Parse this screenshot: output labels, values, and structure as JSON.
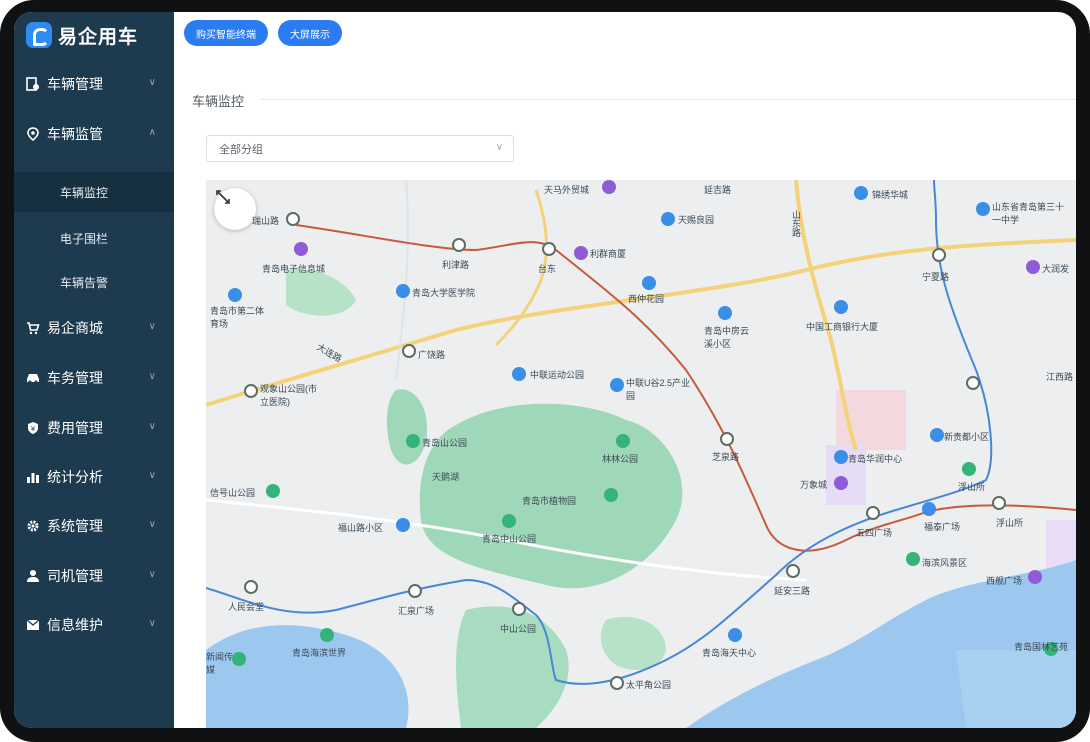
{
  "app": {
    "title": "易企用车"
  },
  "sidebar": {
    "items": [
      {
        "label": "车辆管理",
        "icon": "car-doc-icon"
      },
      {
        "label": "车辆监管",
        "icon": "location-pin-icon"
      },
      {
        "label": "易企商城",
        "icon": "cart-icon"
      },
      {
        "label": "车务管理",
        "icon": "car-icon"
      },
      {
        "label": "费用管理",
        "icon": "shield-icon"
      },
      {
        "label": "统计分析",
        "icon": "bar-chart-icon"
      },
      {
        "label": "系统管理",
        "icon": "gear-icon"
      },
      {
        "label": "司机管理",
        "icon": "user-icon"
      },
      {
        "label": "信息维护",
        "icon": "mail-icon"
      }
    ],
    "subitems": [
      {
        "label": "车辆监控",
        "active": true
      },
      {
        "label": "电子围栏",
        "active": false
      },
      {
        "label": "车辆告警",
        "active": false
      }
    ]
  },
  "topbar": {
    "buy_button": "购买智能终端",
    "screen_button": "大屏展示"
  },
  "section": {
    "title": "车辆监控"
  },
  "group_select": {
    "value": "全部分组"
  },
  "map": {
    "labels": [
      "天马外贸城",
      "延吉路",
      "山东路",
      "锦绣华城",
      "山东省青岛第三十一中学",
      "天赐良园",
      "利群商厦",
      "宁夏路",
      "大润发",
      "瑞山路",
      "利津路",
      "台东",
      "青岛电子信息城",
      "青岛大学医学院",
      "西仲花园",
      "青岛市第二体育场",
      "青岛中房云溪小区",
      "中国工商银行大厦",
      "江西路",
      "广饶路",
      "大连路",
      "中联运动公园",
      "中联U谷2.5产业园",
      "观象山公园(市立医院)",
      "青岛山公园",
      "新贵都小区",
      "天鹅湖",
      "林林公园",
      "芝泉路",
      "青岛华润中心",
      "万象城",
      "浮山所",
      "信号山公园",
      "青岛市植物园",
      "五四广场",
      "福泰广场",
      "浮山所",
      "福山路小区",
      "青岛中山公园",
      "海滨风景区",
      "西舰广场",
      "人民会堂",
      "汇泉广场",
      "中山公园",
      "延安三路",
      "青岛海滨世界",
      "青岛海天中心",
      "太平角公园",
      "青岛国林艺苑",
      "新闻传媒"
    ]
  },
  "colors": {
    "sidebar": "#1e3a4f",
    "accent": "#2b7cf2",
    "map_green": "#a8dcc0",
    "map_water": "#9cc8ef"
  }
}
